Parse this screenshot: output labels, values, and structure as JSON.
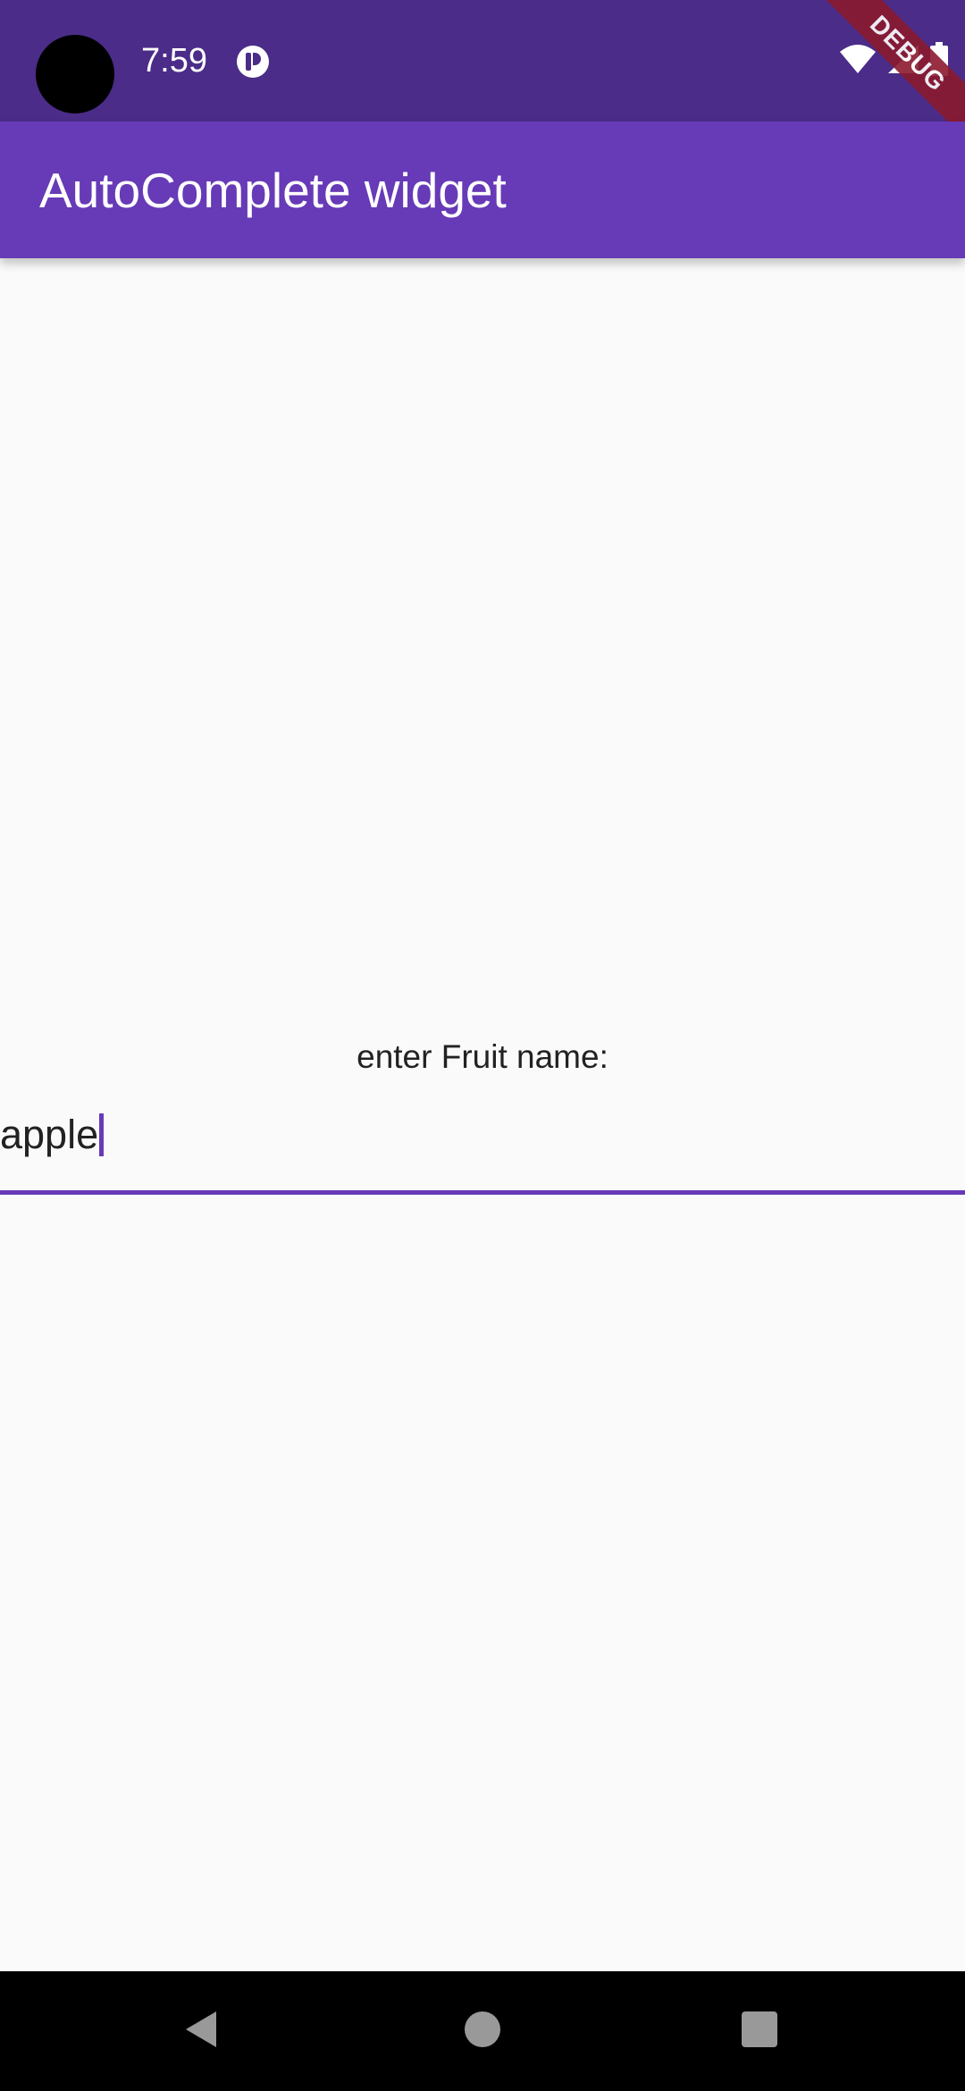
{
  "status_bar": {
    "time": "7:59",
    "icons": [
      "camera-cutout",
      "app-notification-icon",
      "wifi-icon",
      "cellular-signal-icon",
      "battery-icon"
    ]
  },
  "debug_banner": {
    "label": "DEBUG"
  },
  "app_bar": {
    "title": "AutoComplete widget",
    "background": "#673ab7"
  },
  "form": {
    "label": "enter Fruit name:",
    "value": "apple",
    "accent": "#673ab7"
  },
  "nav_bar": {
    "buttons": [
      "back-icon",
      "home-icon",
      "recents-icon"
    ]
  }
}
